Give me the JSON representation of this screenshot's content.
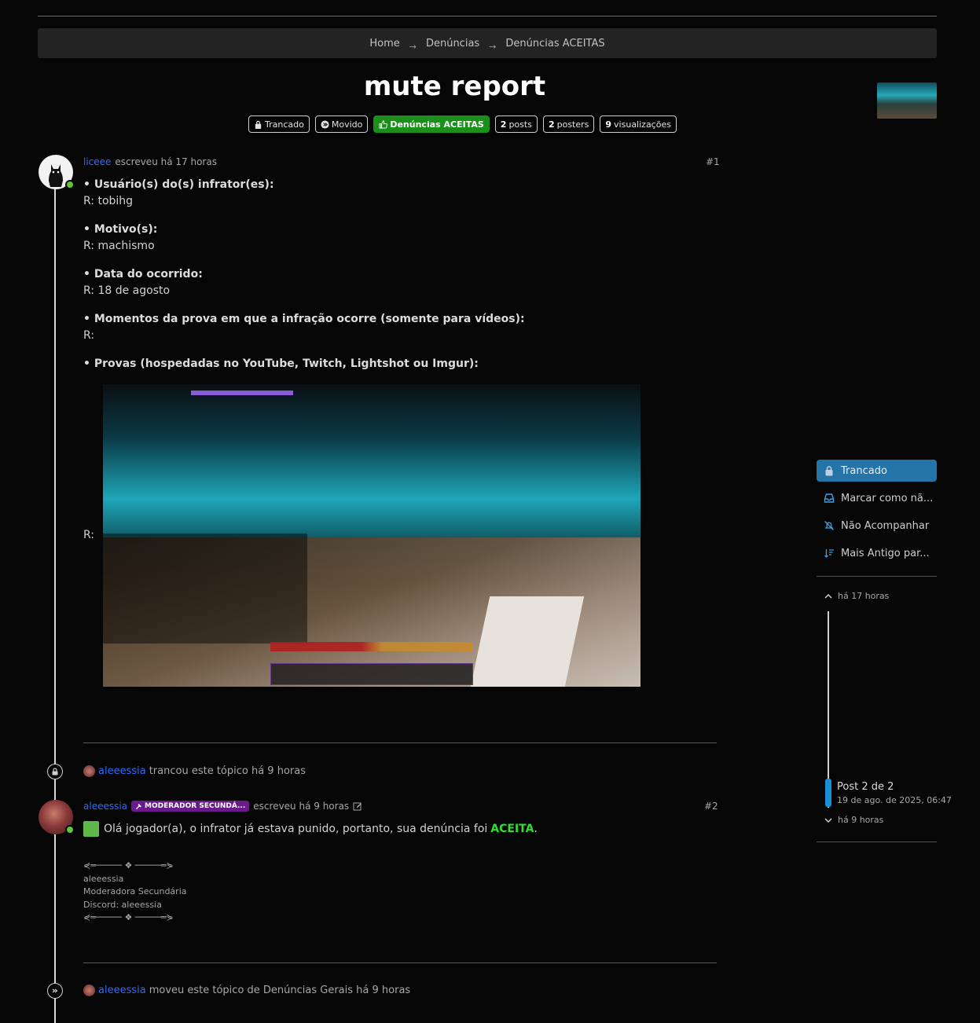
{
  "breadcrumb": {
    "home": "Home",
    "sep": "→",
    "level1": "Denúncias",
    "level2": "Denúncias ACEITAS"
  },
  "topic": {
    "title": "mute report",
    "badges": {
      "locked": "Trancado",
      "moved": "Movido",
      "category": "Denúncias ACEITAS",
      "posts_count": "2",
      "posts_label": "posts",
      "posters_count": "2",
      "posters_label": "posters",
      "views_count": "9",
      "views_label": "visualizações"
    },
    "category_color": "#1a8f1a"
  },
  "post1": {
    "username": "liceee",
    "meta": "escreveu há 17 horas",
    "number": "#1",
    "q1": "• Usuário(s) do(s) infrator(es):",
    "a1": "R: tobihg",
    "q2": "• Motivo(s):",
    "a2": "R: machismo",
    "q3": "• Data do ocorrido:",
    "a3": "R: 18 de agosto",
    "q4": "• Momentos da prova em que a infração ocorre (somente para vídeos):",
    "a4": "R:",
    "q5": "• Provas (hospedadas no YouTube, Twitch, Lightshot ou Imgur):",
    "a5": "R:"
  },
  "event_lock": {
    "user": "aleeessia",
    "text": "trancou este tópico há 9 horas"
  },
  "post2": {
    "username": "aleeessia",
    "badge": "MODERADOR SECUNDÁ...",
    "meta": "escreveu há 9 horas",
    "number": "#2",
    "text": "Olá jogador(a), o infrator já estava punido, portanto, sua denúncia foi",
    "highlight": "ACEITA",
    "end": ".",
    "sig": {
      "deco": "⋞═───── ❖ ─────═⋟",
      "name": "aleeessia",
      "role": "Moderadora Secundária",
      "discord": "Discord: aleeessia"
    }
  },
  "event_move": {
    "user": "aleeessia",
    "text": "moveu este tópico de Denúncias Gerais há 9 horas"
  },
  "sidebar": {
    "locked": "Trancado",
    "mark_unread": "Marcar como nã...",
    "unwatch": "Não Acompanhar",
    "sort": "Mais Antigo par...",
    "timeline_top": "há 17 horas",
    "timeline_post": "Post 2 de 2",
    "timeline_date": "19 de ago. de 2025, 06:47",
    "timeline_bottom": "há 9 horas"
  }
}
